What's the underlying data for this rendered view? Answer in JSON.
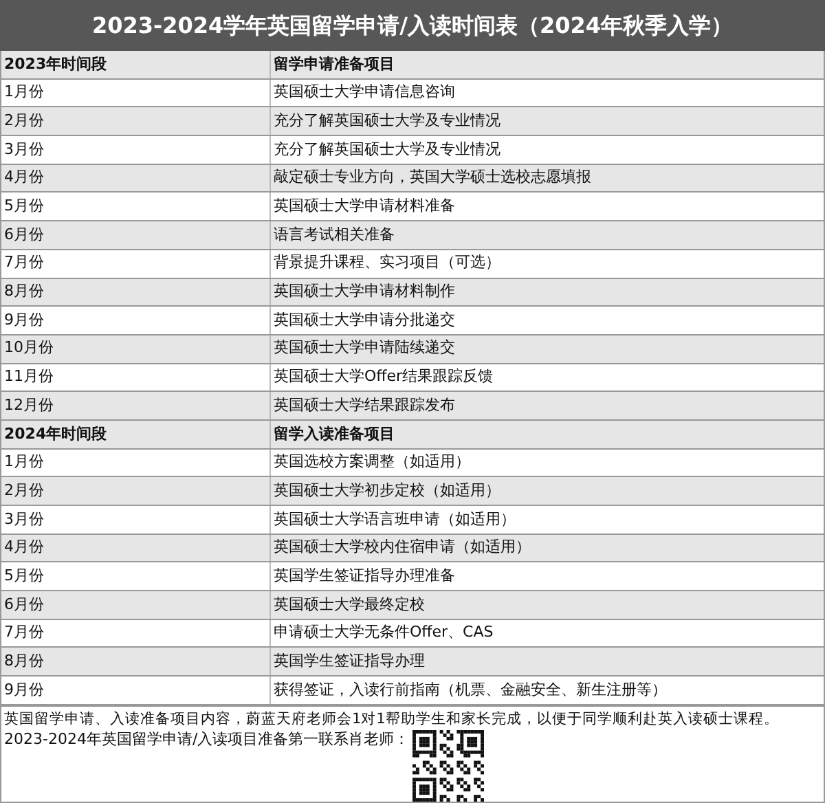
{
  "title": "2023-2024学年英国留学申请/入读时间表（2024年秋季入学）",
  "sections": [
    {
      "header": [
        "2023年时间段",
        "留学申请准备项目"
      ],
      "rows": [
        [
          "1月份",
          "英国硕士大学申请信息咨询"
        ],
        [
          "2月份",
          "充分了解英国硕士大学及专业情况"
        ],
        [
          "3月份",
          "充分了解英国硕士大学及专业情况"
        ],
        [
          "4月份",
          "敲定硕士专业方向，英国大学硕士选校志愿填报"
        ],
        [
          "5月份",
          "英国硕士大学申请材料准备"
        ],
        [
          "6月份",
          "语言考试相关准备"
        ],
        [
          "7月份",
          "背景提升课程、实习项目（可选）"
        ],
        [
          "8月份",
          "英国硕士大学申请材料制作"
        ],
        [
          "9月份",
          "英国硕士大学申请分批递交"
        ],
        [
          "10月份",
          "英国硕士大学申请陆续递交"
        ],
        [
          "11月份",
          "英国硕士大学Offer结果跟踪反馈"
        ],
        [
          "12月份",
          "英国硕士大学结果跟踪发布"
        ]
      ]
    },
    {
      "header": [
        "2024年时间段",
        "留学入读准备项目"
      ],
      "rows": [
        [
          "1月份",
          "英国选校方案调整（如适用）"
        ],
        [
          "2月份",
          "英国硕士大学初步定校（如适用）"
        ],
        [
          "3月份",
          "英国硕士大学语言班申请（如适用）"
        ],
        [
          "4月份",
          "英国硕士大学校内住宿申请（如适用）"
        ],
        [
          "5月份",
          "英国学生签证指导办理准备"
        ],
        [
          "6月份",
          "英国硕士大学最终定校"
        ],
        [
          "7月份",
          "申请硕士大学无条件Offer、CAS"
        ],
        [
          "8月份",
          "英国学生签证指导办理"
        ],
        [
          "9月份",
          "获得签证，入读行前指南（机票、金融安全、新生注册等）"
        ]
      ]
    }
  ],
  "footer": {
    "note": "英国留学申请、入读准备项目内容，蔚蓝天府老师会1对1帮助学生和家长完成，以便于同学顺利赴英入读硕士课程。",
    "contact": "2023-2024年英国留学申请/入读项目准备第一联系肖老师："
  }
}
